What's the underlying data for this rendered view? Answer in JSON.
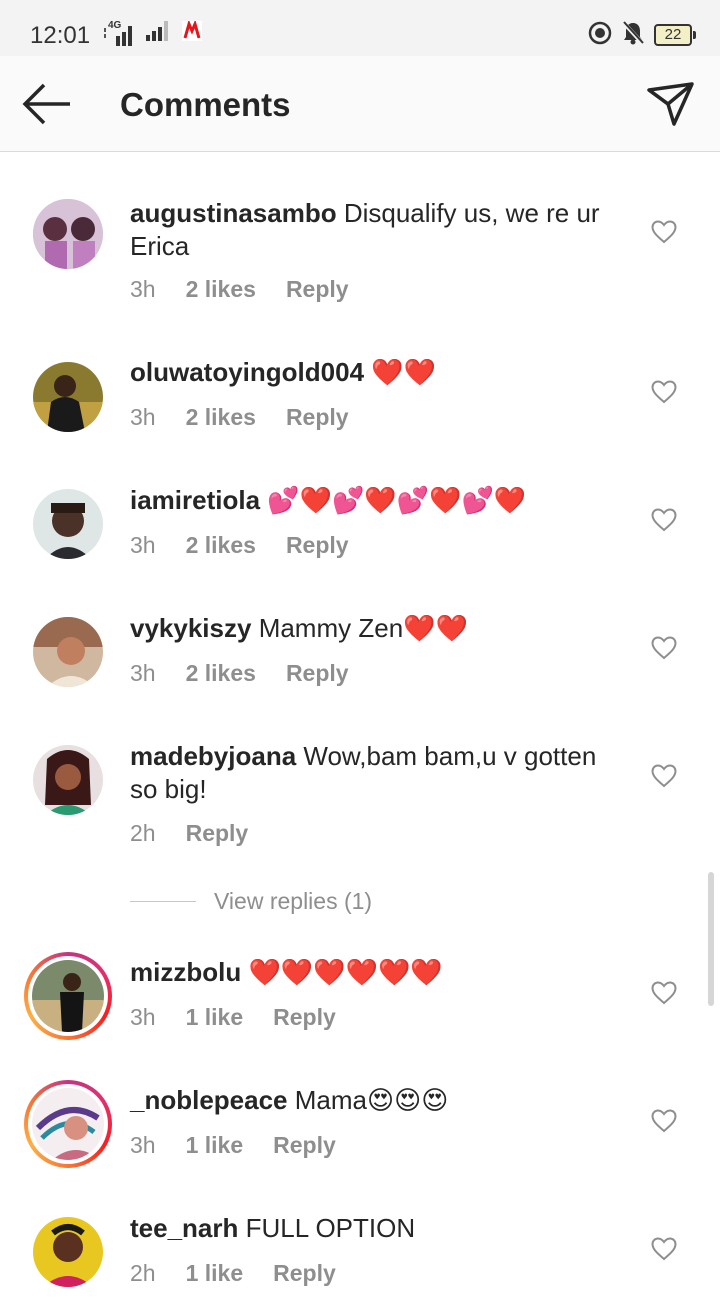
{
  "status_bar": {
    "time": "12:01",
    "network_label": "4G",
    "battery_level": "22",
    "icons": [
      "signal-icon",
      "signal-icon",
      "news-app-icon",
      "data-saver-icon",
      "bell-muted-icon",
      "battery-icon"
    ]
  },
  "header": {
    "title": "Comments",
    "back_icon": "arrow-left-icon",
    "share_icon": "send-icon"
  },
  "comments": [
    {
      "username": "augustinasambo",
      "text": "Disqualify us, we re ur Erica",
      "time": "3h",
      "likes": "2 likes",
      "reply": "Reply",
      "story_ring": false
    },
    {
      "username": "oluwatoyingold004",
      "text": "❤️❤️",
      "time": "3h",
      "likes": "2 likes",
      "reply": "Reply",
      "story_ring": false
    },
    {
      "username": "iamiretiola",
      "text": "💕❤️💕❤️💕❤️💕❤️",
      "time": "3h",
      "likes": "2 likes",
      "reply": "Reply",
      "story_ring": false
    },
    {
      "username": "vykykiszy",
      "text": "Mammy Zen❤️❤️",
      "time": "3h",
      "likes": "2 likes",
      "reply": "Reply",
      "story_ring": false
    },
    {
      "username": "madebyjoana",
      "text": "Wow,bam bam,u v gotten so big!",
      "time": "2h",
      "likes": "",
      "reply": "Reply",
      "story_ring": false
    },
    {
      "username": "mizzbolu",
      "text": "❤️❤️❤️❤️❤️❤️",
      "time": "3h",
      "likes": "1 like",
      "reply": "Reply",
      "story_ring": true
    },
    {
      "username": "_noblepeace",
      "text": "Mama😍😍😍",
      "time": "3h",
      "likes": "1 like",
      "reply": "Reply",
      "story_ring": true
    },
    {
      "username": "tee_narh",
      "text": "FULL OPTION",
      "time": "2h",
      "likes": "1 like",
      "reply": "Reply",
      "story_ring": false
    }
  ],
  "view_replies": "View replies (1)",
  "colors": {
    "heart_red": "#ed1c24",
    "meta_gray": "#8e8e8e",
    "story_ring": "#e1306c"
  }
}
